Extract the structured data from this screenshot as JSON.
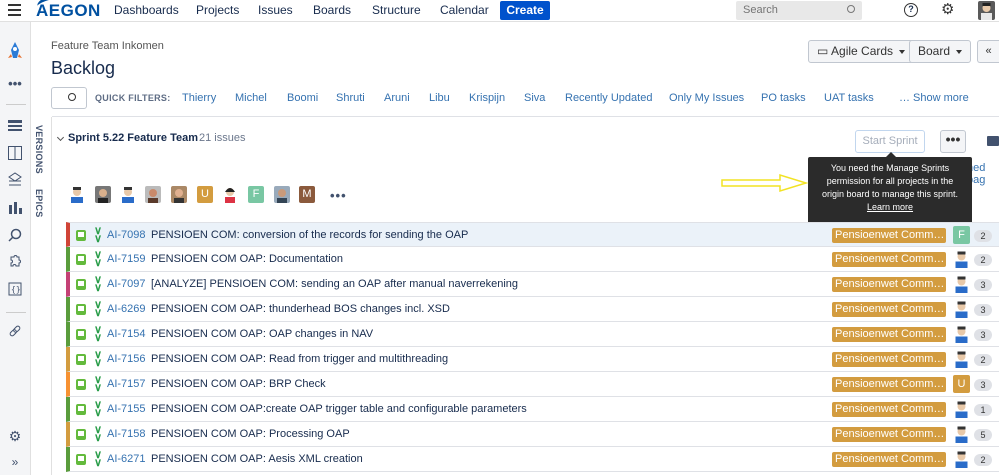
{
  "topnav": {
    "logo": "AEGON",
    "items": [
      "Dashboards",
      "Projects",
      "Issues",
      "Boards",
      "Structure",
      "Calendar"
    ],
    "create": "Create",
    "search_placeholder": "Search"
  },
  "header": {
    "breadcrumb": "Feature Team Inkomen",
    "title": "Backlog",
    "agile_cards": "Agile Cards",
    "board": "Board"
  },
  "quick_filters": {
    "label": "QUICK FILTERS:",
    "items": [
      "Thierry",
      "Michel",
      "Boomi",
      "Shruti",
      "Aruni",
      "Libu",
      "Krispijn",
      "Siva",
      "Recently Updated",
      "Only My Issues",
      "PO tasks",
      "UAT tasks"
    ],
    "show_more": "… Show more"
  },
  "vertical_tabs": [
    "VERSIONS",
    "EPICS"
  ],
  "sprint": {
    "name": "Sprint 5.22 Feature Team",
    "count": "21 issues",
    "start_button": "Start Sprint",
    "more": "•••",
    "side_link": "ned pag"
  },
  "tooltip": {
    "text": "You need the Manage Sprints permission for all projects in the origin board to manage this sprint.",
    "link": "Learn more"
  },
  "assignee_letters": [
    "U",
    "F",
    "M"
  ],
  "assignee_more": "•••",
  "issues": [
    {
      "key": "AI-7098",
      "summary": "PENSIOEN COM: conversion of the records for sending the OAP",
      "epic": "Pensioenwet Comm…",
      "points": "2",
      "avatar": "F",
      "bar": "#d04437"
    },
    {
      "key": "AI-7159",
      "summary": "PENSIOEN COM OAP: Documentation",
      "epic": "Pensioenwet Comm…",
      "points": "2",
      "avatar": "",
      "bar": "#5a9c3c"
    },
    {
      "key": "AI-7097",
      "summary": "[ANALYZE] PENSIOEN COM: sending an OAP after manual naverrekening",
      "epic": "Pensioenwet Comm…",
      "points": "3",
      "avatar": "",
      "bar": "#c44175"
    },
    {
      "key": "AI-6269",
      "summary": "PENSIOEN COM OAP: thunderhead BOS changes incl. XSD",
      "epic": "Pensioenwet Comm…",
      "points": "3",
      "avatar": "",
      "bar": "#5a9c3c"
    },
    {
      "key": "AI-7154",
      "summary": "PENSIOEN COM OAP: OAP changes in NAV",
      "epic": "Pensioenwet Comm…",
      "points": "3",
      "avatar": "",
      "bar": "#5a9c3c"
    },
    {
      "key": "AI-7156",
      "summary": "PENSIOEN COM OAP: Read from trigger and multithreading",
      "epic": "Pensioenwet Comm…",
      "points": "2",
      "avatar": "",
      "bar": "#d39c3f"
    },
    {
      "key": "AI-7157",
      "summary": "PENSIOEN COM OAP: BRP Check",
      "epic": "Pensioenwet Comm…",
      "points": "3",
      "avatar": "U",
      "bar": "#f79232"
    },
    {
      "key": "AI-7155",
      "summary": "PENSIOEN COM OAP:create OAP trigger table and configurable parameters",
      "epic": "Pensioenwet Comm…",
      "points": "1",
      "avatar": "",
      "bar": "#5a9c3c"
    },
    {
      "key": "AI-7158",
      "summary": "PENSIOEN COM OAP: Processing OAP",
      "epic": "Pensioenwet Comm…",
      "points": "5",
      "avatar": "",
      "bar": "#d39c3f"
    },
    {
      "key": "AI-6271",
      "summary": "PENSIOEN COM OAP: Aesis XML creation",
      "epic": "Pensioenwet Comm…",
      "points": "2",
      "avatar": "",
      "bar": "#5a9c3c"
    }
  ]
}
